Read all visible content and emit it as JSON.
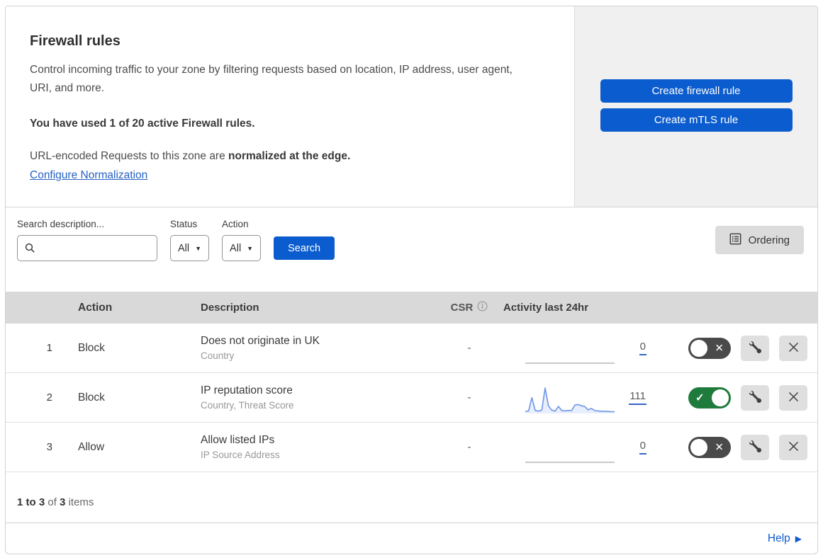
{
  "header": {
    "title": "Firewall rules",
    "description": "Control incoming traffic to your zone by filtering requests based on location, IP address, user agent, URI, and more.",
    "usage_notice": "You have used 1 of 20 active Firewall rules.",
    "normalization_prefix": "URL-encoded Requests to this zone are ",
    "normalization_bold": "normalized at the edge.",
    "normalization_link": "Configure Normalization"
  },
  "actions_panel": {
    "create_firewall_label": "Create firewall rule",
    "create_mtls_label": "Create mTLS rule"
  },
  "filters": {
    "search_label": "Search description...",
    "status_label": "Status",
    "status_value": "All",
    "action_label": "Action",
    "action_value": "All",
    "search_button_label": "Search",
    "ordering_button_label": "Ordering"
  },
  "table": {
    "columns": {
      "action": "Action",
      "description": "Description",
      "csr": "CSR",
      "activity": "Activity last 24hr"
    },
    "rows": [
      {
        "index": "1",
        "action": "Block",
        "description": "Does not originate in UK",
        "expression": "Country",
        "csr": "-",
        "activity_count": "0",
        "enabled": false,
        "has_sparkline": false
      },
      {
        "index": "2",
        "action": "Block",
        "description": "IP reputation score",
        "expression": "Country, Threat Score",
        "csr": "-",
        "activity_count": "111",
        "enabled": true,
        "has_sparkline": true
      },
      {
        "index": "3",
        "action": "Allow",
        "description": "Allow listed IPs",
        "expression": "IP Source Address",
        "csr": "-",
        "activity_count": "0",
        "enabled": false,
        "has_sparkline": false
      }
    ],
    "sparkline": {
      "type": "area",
      "values": [
        8,
        10,
        62,
        12,
        9,
        13,
        100,
        30,
        13,
        9,
        28,
        12,
        10,
        12,
        11,
        33,
        35,
        30,
        27,
        14,
        20,
        11,
        10,
        9,
        8,
        8,
        7,
        7
      ]
    }
  },
  "footer": {
    "range_bold": "1 to 3",
    "of_text": "of",
    "total_bold": "3",
    "items_text": "items"
  },
  "help": {
    "label": "Help"
  },
  "icons": {
    "check": "✓",
    "x_mark": "✕",
    "caret_down": "▼",
    "help_arrow": "▶"
  },
  "colors": {
    "accent_blue": "#0b5cce",
    "link_blue": "#2560c4",
    "toggle_on_green": "#1f7b3c",
    "toggle_off_gray": "#4a4a4a",
    "sparkline_blue": "#6d96e8",
    "table_header_gray": "#d9d9d9",
    "panel_gray": "#f0f0f0"
  }
}
